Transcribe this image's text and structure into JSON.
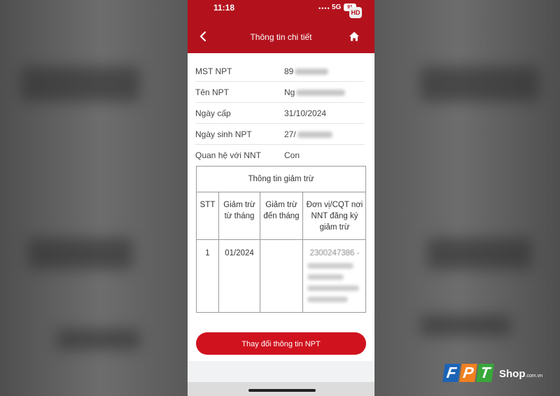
{
  "status_bar": {
    "time": "11:18",
    "signal": "••••",
    "network": "5G",
    "battery": "91",
    "badge": "HD"
  },
  "header": {
    "title": "Thông tin chi tiết",
    "back_icon": "chevron-left-icon",
    "home_icon": "home-icon"
  },
  "fields": [
    {
      "label": "MST NPT",
      "value": "89"
    },
    {
      "label": "Tên NPT",
      "value": "Ng"
    },
    {
      "label": "Ngày cấp",
      "value": "31/10/2024"
    },
    {
      "label": "Ngày sinh NPT",
      "value": "27/"
    },
    {
      "label": "Quan hệ với NNT",
      "value": "Con"
    }
  ],
  "deduction_table": {
    "title": "Thông tin giảm trừ",
    "columns": [
      "STT",
      "Giảm trừ từ tháng",
      "Giảm trừ đến tháng",
      "Đơn vị/CQT nơi NNT đăng ký giảm trừ"
    ],
    "rows": [
      {
        "stt": "1",
        "from": "01/2024",
        "to": "",
        "unit": "2300247386 -"
      }
    ]
  },
  "actions": {
    "change_button": "Thay đổi thông tin NPT"
  },
  "watermark": {
    "brand": "FPT",
    "shop": "Shop",
    "domain": ".com.vn"
  },
  "colors": {
    "brand_red": "#b3121d",
    "button_red": "#d0121e"
  }
}
